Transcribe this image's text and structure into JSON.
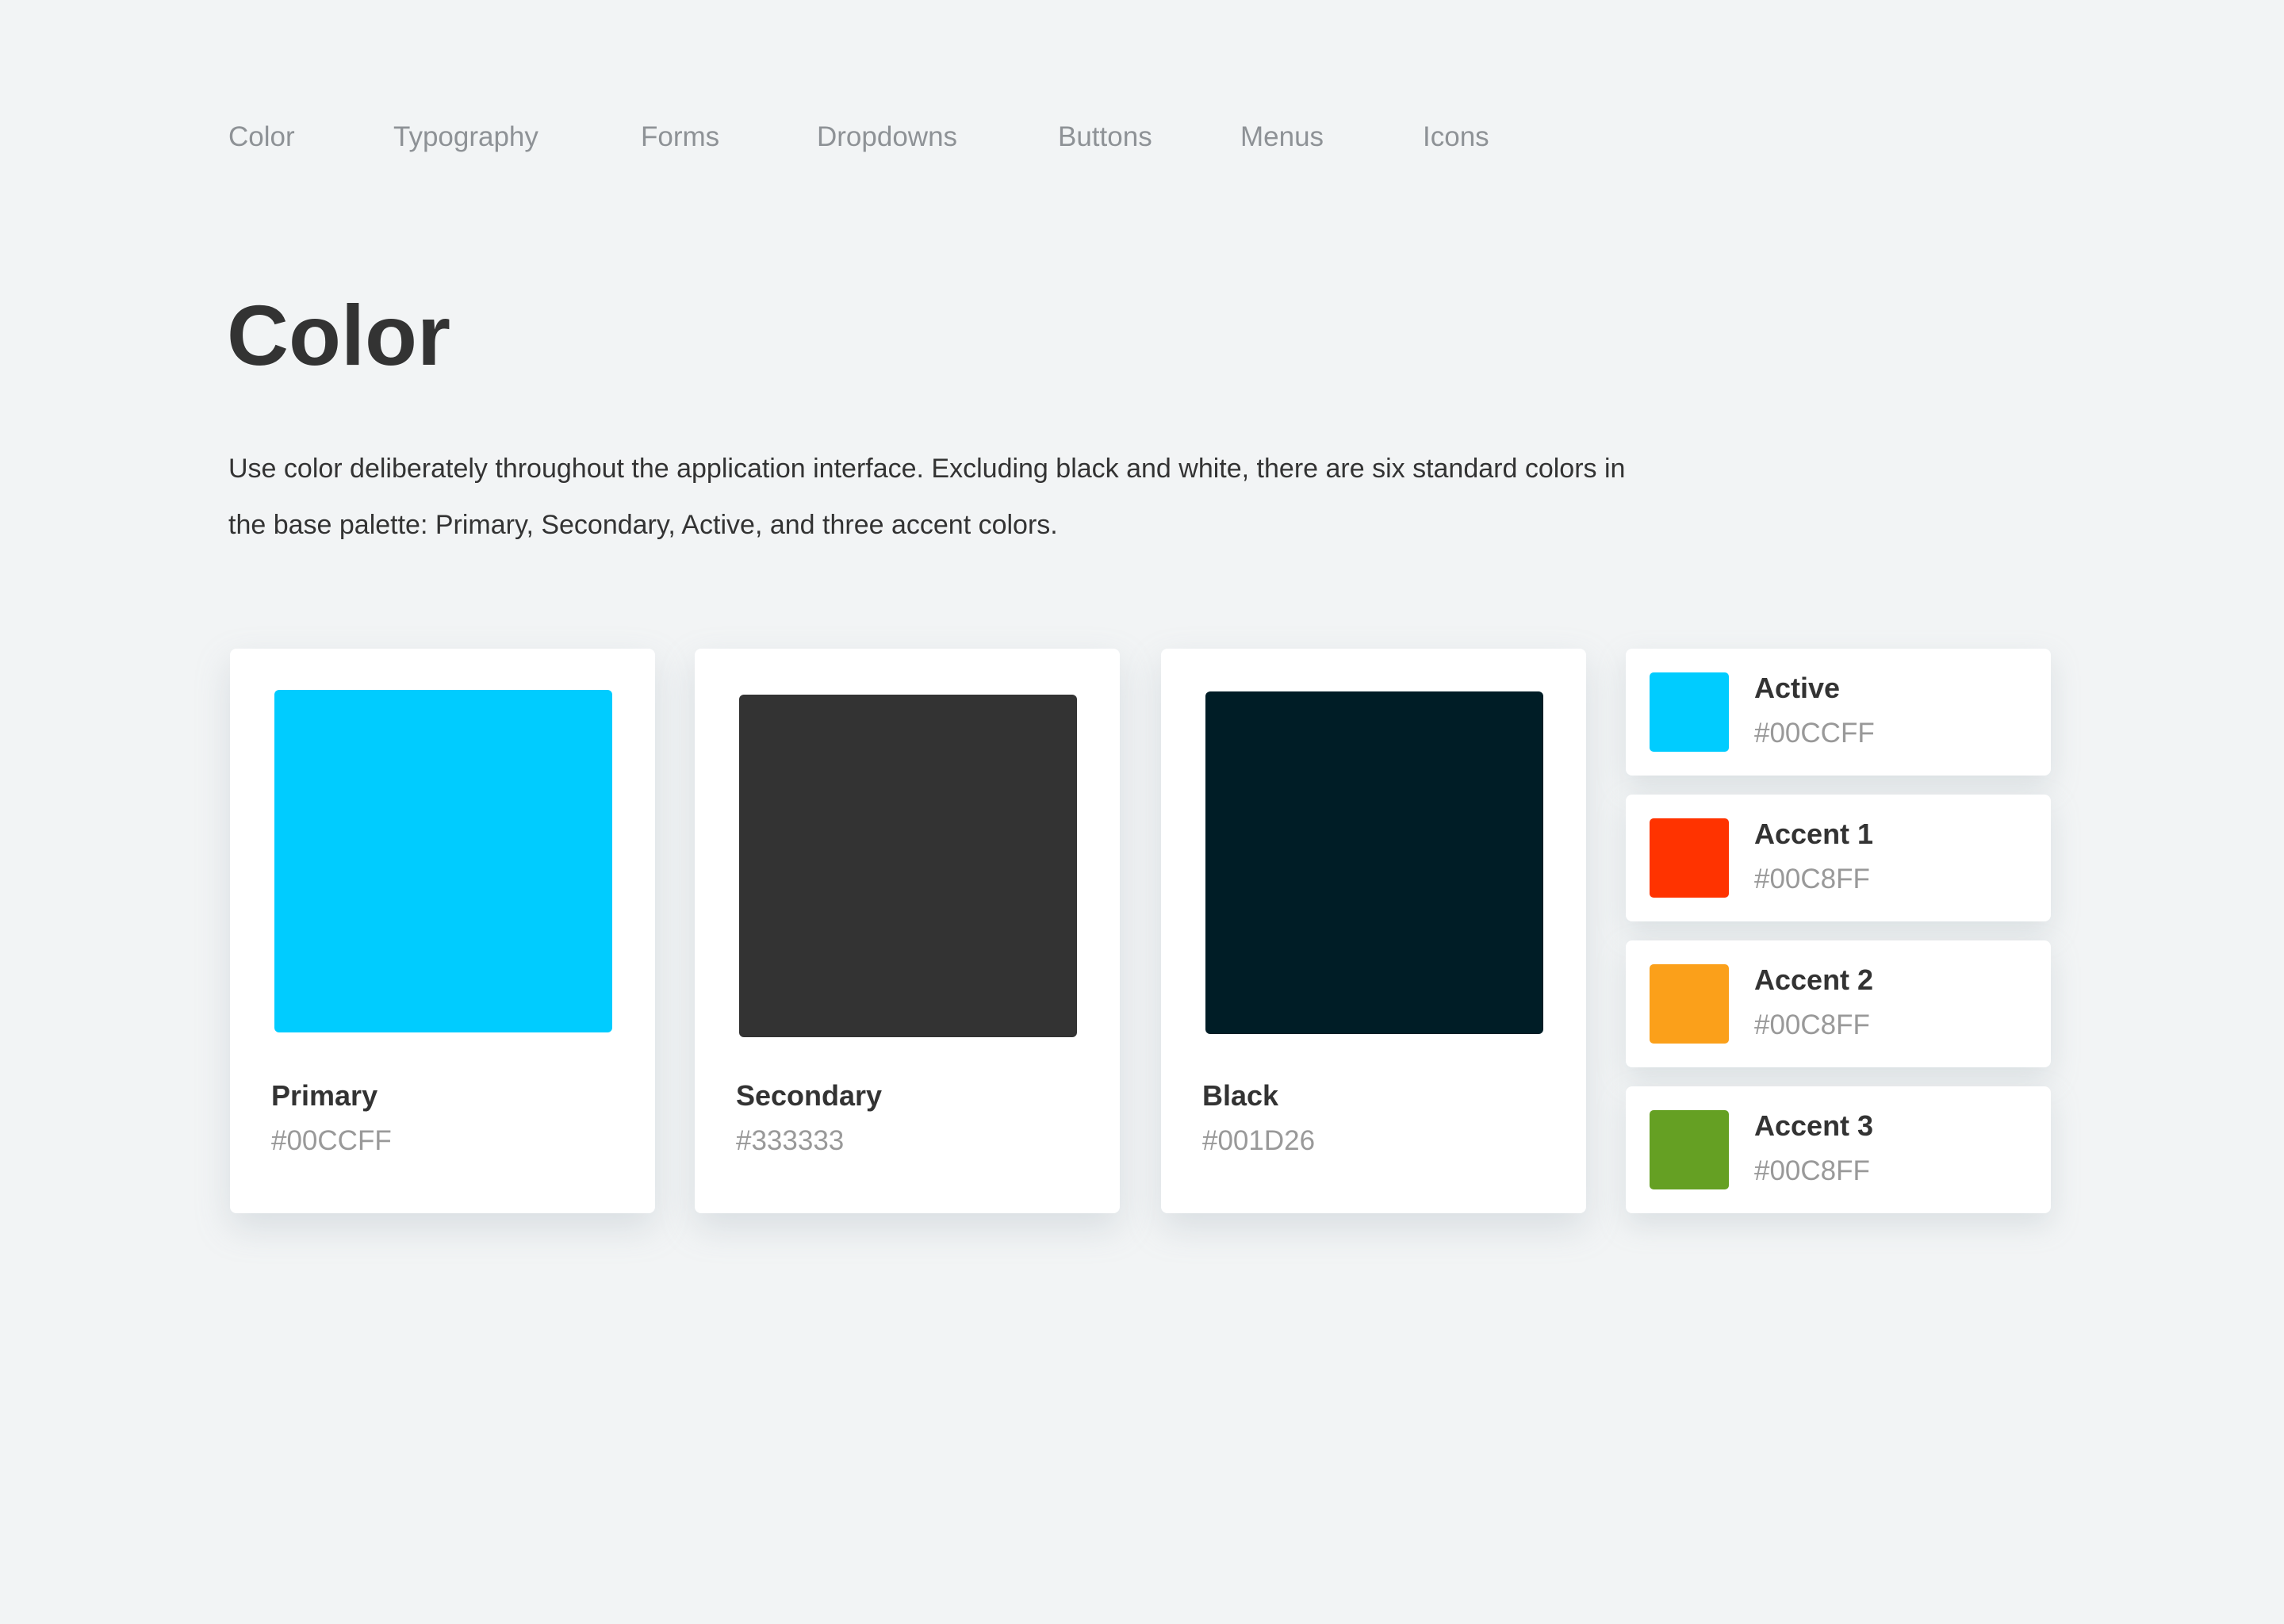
{
  "nav": {
    "items": [
      {
        "label": "Color"
      },
      {
        "label": "Typography"
      },
      {
        "label": "Forms"
      },
      {
        "label": "Dropdowns"
      },
      {
        "label": "Buttons"
      },
      {
        "label": "Menus"
      },
      {
        "label": "Icons"
      }
    ]
  },
  "header": {
    "title": "Color",
    "description": "Use color deliberately throughout the application interface. Excluding black and white, there are six standard colors in the base palette: Primary, Secondary, Active, and three accent colors."
  },
  "palette": {
    "primary": {
      "name": "Primary",
      "hex": "#00CCFF",
      "swatch_color": "#00CCFF"
    },
    "secondary": {
      "name": "Secondary",
      "hex": "#333333",
      "swatch_color": "#333333"
    },
    "black": {
      "name": "Black",
      "hex": "#001D26",
      "swatch_color": "#001D26"
    },
    "active": {
      "name": "Active",
      "hex": "#00CCFF",
      "swatch_color": "#00CCFF"
    },
    "accent1": {
      "name": "Accent 1",
      "hex": "#00C8FF",
      "swatch_color": "#FF3300"
    },
    "accent2": {
      "name": "Accent 2",
      "hex": "#00C8FF",
      "swatch_color": "#FBA01A"
    },
    "accent3": {
      "name": "Accent 3",
      "hex": "#00C8FF",
      "swatch_color": "#65A023"
    }
  }
}
